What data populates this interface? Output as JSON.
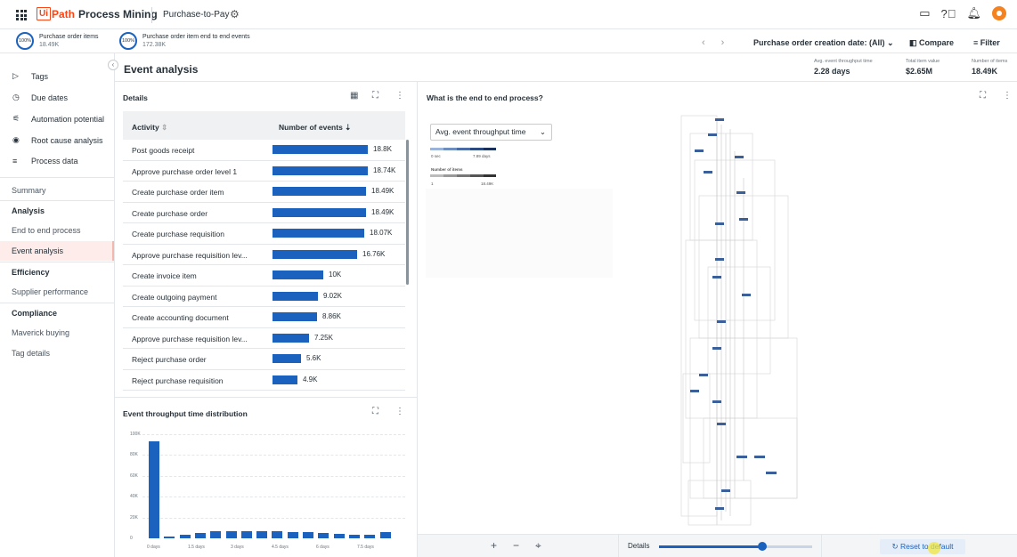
{
  "app": {
    "brand_ui": "Ui",
    "brand_path": "Path",
    "brand_product": "Process Mining",
    "title": "Purchase-to-Pay"
  },
  "kpis": [
    {
      "pct": "100%",
      "label": "Purchase order items",
      "value": "18.49K"
    },
    {
      "pct": "100%",
      "label": "Purchase order item end to end events",
      "value": "172.38K"
    }
  ],
  "topbar": {
    "date_filter": "Purchase order creation date: (All)",
    "compare": "Compare",
    "filter": "Filter"
  },
  "sidebar": {
    "top": [
      "Tags",
      "Due dates",
      "Automation potential",
      "Root cause analysis",
      "Process data"
    ],
    "items": [
      {
        "label": "Summary",
        "type": "item"
      },
      {
        "label": "Analysis",
        "type": "head"
      },
      {
        "label": "End to end process",
        "type": "item"
      },
      {
        "label": "Event analysis",
        "type": "active"
      },
      {
        "label": "Efficiency",
        "type": "head"
      },
      {
        "label": "Supplier performance",
        "type": "item"
      },
      {
        "label": "Compliance",
        "type": "head"
      },
      {
        "label": "Maverick buying",
        "type": "item"
      },
      {
        "label": "Tag details",
        "type": "item"
      }
    ]
  },
  "page": {
    "title": "Event analysis",
    "header_kpis": [
      {
        "label": "Avg. event throughput time",
        "value": "2.28 days"
      },
      {
        "label": "Total item value",
        "value": "$2.65M"
      },
      {
        "label": "Number of items",
        "value": "18.49K"
      }
    ]
  },
  "details": {
    "title": "Details",
    "col_activity": "Activity",
    "col_events": "Number of events",
    "rows": [
      {
        "activity": "Post goods receipt",
        "label": "18.8K",
        "value": 18800
      },
      {
        "activity": "Approve purchase order level 1",
        "label": "18.74K",
        "value": 18740
      },
      {
        "activity": "Create purchase order item",
        "label": "18.49K",
        "value": 18490
      },
      {
        "activity": "Create purchase order",
        "label": "18.49K",
        "value": 18490
      },
      {
        "activity": "Create purchase requisition",
        "label": "18.07K",
        "value": 18070
      },
      {
        "activity": "Approve purchase requisition lev...",
        "label": "16.76K",
        "value": 16760
      },
      {
        "activity": "Create invoice item",
        "label": "10K",
        "value": 10000
      },
      {
        "activity": "Create outgoing payment",
        "label": "9.02K",
        "value": 9020
      },
      {
        "activity": "Create accounting document",
        "label": "8.86K",
        "value": 8860
      },
      {
        "activity": "Approve purchase requisition lev...",
        "label": "7.25K",
        "value": 7250
      },
      {
        "activity": "Reject purchase order",
        "label": "5.6K",
        "value": 5600
      },
      {
        "activity": "Reject purchase requisition",
        "label": "4.9K",
        "value": 4900
      }
    ]
  },
  "distribution": {
    "title": "Event throughput time distribution",
    "yticks": [
      "100K",
      "80K",
      "60K",
      "40K",
      "20K",
      "0"
    ],
    "xticks": [
      "0 days",
      "1.5 days",
      "3 days",
      "4.5 days",
      "6 days",
      "7.5 days"
    ]
  },
  "chart_data": {
    "type": "bar",
    "title": "Event throughput time distribution",
    "ylim": [
      0,
      100000
    ],
    "values": [
      93000,
      1500,
      3000,
      5000,
      6500,
      7000,
      7200,
      7000,
      6800,
      6200,
      5800,
      5000,
      4200,
      3800,
      3500,
      6000
    ]
  },
  "e2e": {
    "title": "What is the end to end process?",
    "metric": "Avg. event throughput time",
    "legend_time_min": "0 sec",
    "legend_time_max": "7.89 days",
    "legend_items_title": "Number of items",
    "legend_items_min": "1",
    "legend_items_max": "18.49K",
    "details_label": "Details",
    "reset": "Reset to default"
  }
}
